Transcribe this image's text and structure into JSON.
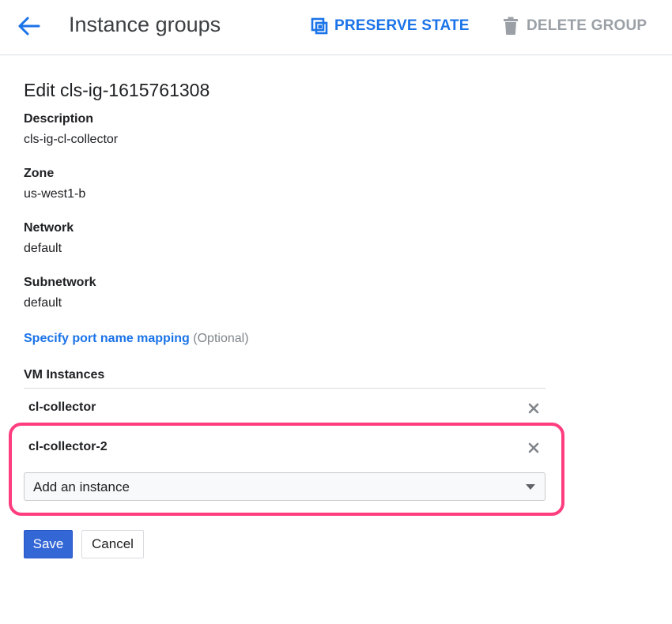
{
  "header": {
    "title": "Instance groups",
    "preserve_state_label": "PRESERVE STATE",
    "delete_group_label": "DELETE GROUP"
  },
  "form": {
    "title": "Edit cls-ig-1615761308",
    "fields": [
      {
        "label": "Description",
        "value": "cls-ig-cl-collector"
      },
      {
        "label": "Zone",
        "value": "us-west1-b"
      },
      {
        "label": "Network",
        "value": "default"
      },
      {
        "label": "Subnetwork",
        "value": "default"
      }
    ],
    "port_mapping_link": "Specify port name mapping",
    "port_mapping_optional": "(Optional)",
    "vm_instances_label": "VM Instances",
    "vm_instances": [
      "cl-collector",
      "cl-collector-2"
    ],
    "add_instance_value": "Add an instance",
    "save_label": "Save",
    "cancel_label": "Cancel"
  },
  "icons": {
    "back": "arrow-back-icon",
    "preserve": "preserve-state-icon",
    "delete": "trash-icon",
    "remove": "close-icon",
    "dropdown": "caret-down-icon"
  },
  "colors": {
    "accent": "#1a73e8",
    "primary_button": "#3367d6",
    "disabled": "#9aa0a6",
    "highlight": "#ff3d7f"
  }
}
